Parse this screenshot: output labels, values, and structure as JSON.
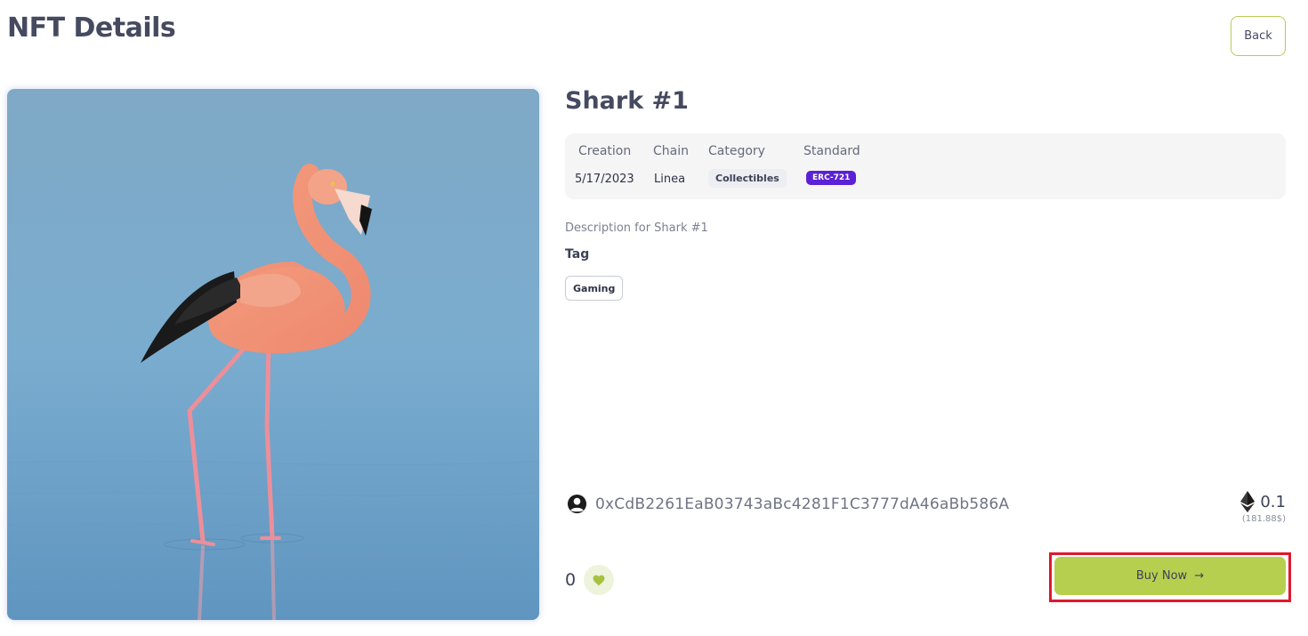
{
  "header": {
    "title": "NFT Details",
    "back_label": "Back"
  },
  "nft": {
    "name": "Shark #1",
    "image_alt": "flamingo standing in water",
    "info": {
      "creation_label": "Creation",
      "creation_value": "5/17/2023",
      "chain_label": "Chain",
      "chain_value": "Linea",
      "category_label": "Category",
      "category_value": "Collectibles",
      "standard_label": "Standard",
      "standard_value": "ERC-721"
    },
    "description": "Description for Shark #1",
    "tag_heading": "Tag",
    "tags": [
      "Gaming"
    ],
    "owner": {
      "icon": "user-circle-icon",
      "address": "0xCdB2261EaB03743aBc4281F1C3777dA46aBb586A"
    },
    "price": {
      "icon": "ethereum-icon",
      "value": "0.1",
      "usd": "(181.88$)"
    },
    "likes": {
      "count": "0",
      "icon": "heart-icon"
    },
    "buy": {
      "label": "Buy Now",
      "arrow": "→"
    }
  },
  "colors": {
    "accent": "#b7cf4f",
    "standard_badge": "#5b21d6",
    "highlight": "#e0182d",
    "title": "#454a60"
  }
}
